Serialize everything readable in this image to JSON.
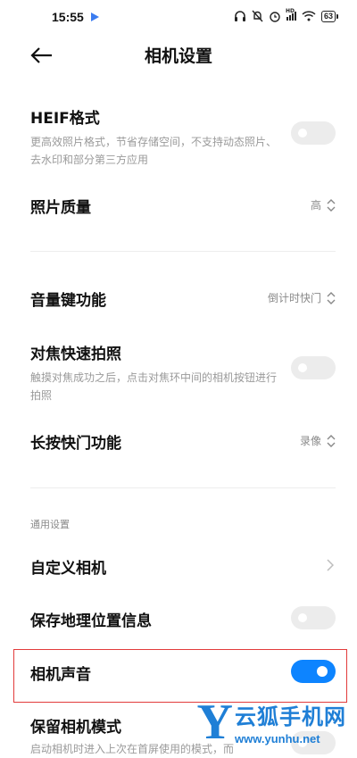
{
  "status": {
    "time": "15:55",
    "hd_badge": "HD",
    "battery": "63"
  },
  "header": {
    "title": "相机设置"
  },
  "heif": {
    "label": "HEIF格式",
    "desc": "更高效照片格式，节省存储空间，不支持动态照片、去水印和部分第三方应用",
    "enabled": false
  },
  "photo_quality": {
    "label": "照片质量",
    "value": "高"
  },
  "volume_key": {
    "label": "音量键功能",
    "value": "倒计时快门"
  },
  "focus_shot": {
    "label": "对焦快速拍照",
    "desc": "触摸对焦成功之后，点击对焦环中间的相机按钮进行拍照",
    "enabled": false
  },
  "long_press": {
    "label": "长按快门功能",
    "value": "录像"
  },
  "general_section": {
    "title": "通用设置"
  },
  "custom_camera": {
    "label": "自定义相机"
  },
  "save_location": {
    "label": "保存地理位置信息",
    "enabled": false
  },
  "camera_sound": {
    "label": "相机声音",
    "enabled": true
  },
  "keep_mode": {
    "label": "保留相机模式",
    "desc": "启动相机时进入上次在首屏使用的模式，而",
    "enabled": false
  },
  "watermark": {
    "logo_letter": "Y",
    "name": "云狐手机网",
    "url": "www.yunhu.net"
  },
  "colors": {
    "accent": "#0d84ff",
    "highlight_border": "#e23b3b",
    "watermark": "#1f7fd6"
  }
}
